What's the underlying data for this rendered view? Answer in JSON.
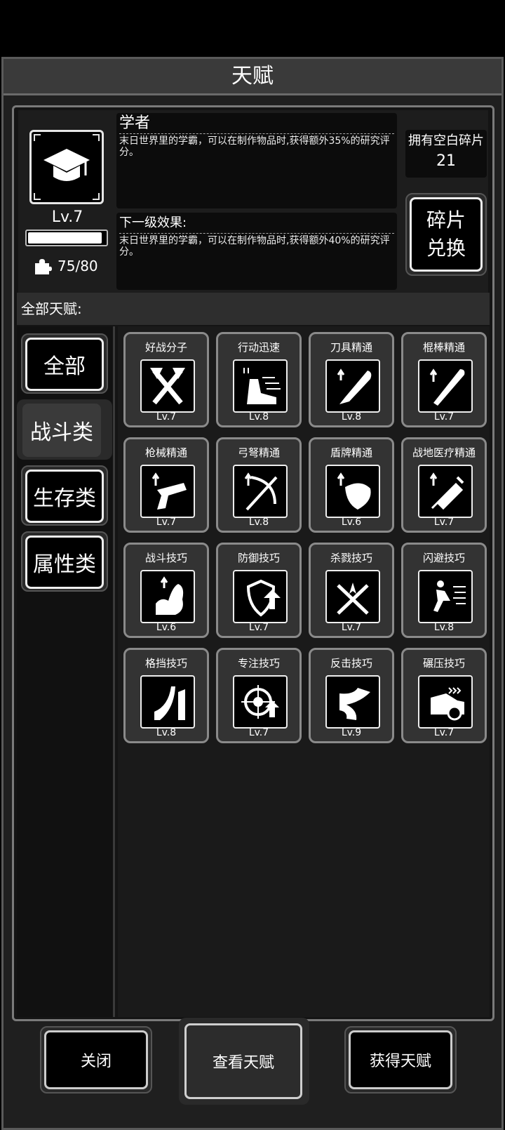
{
  "window": {
    "title": "天赋"
  },
  "talent": {
    "level": "Lv.7",
    "exp_fraction": 0.95,
    "fragments": "75/80",
    "name": "学者",
    "description": "末日世界里的学霸，可以在制作物品时,获得额外35%的研究评分。",
    "next_title": "下一级效果:",
    "next_description": "末日世界里的学霸，可以在制作物品时,获得额外40%的研究评分。",
    "icon": "graduation-cap-icon"
  },
  "fragments_panel": {
    "label": "拥有空白碎片",
    "value": "21",
    "exchange_button": "碎片兑换"
  },
  "section_label": "全部天赋:",
  "categories": [
    {
      "label": "全部",
      "active": false
    },
    {
      "label": "战斗类",
      "active": true
    },
    {
      "label": "生存类",
      "active": false
    },
    {
      "label": "属性类",
      "active": false
    }
  ],
  "talents": [
    {
      "name": "好战分子",
      "level": "Lv.7",
      "icon": "crossed-axes-icon"
    },
    {
      "name": "行动迅速",
      "level": "Lv.8",
      "icon": "fast-boot-icon"
    },
    {
      "name": "刀具精通",
      "level": "Lv.8",
      "icon": "machete-icon"
    },
    {
      "name": "棍棒精通",
      "level": "Lv.7",
      "icon": "bat-icon"
    },
    {
      "name": "枪械精通",
      "level": "Lv.7",
      "icon": "pistol-icon"
    },
    {
      "name": "弓弩精通",
      "level": "Lv.8",
      "icon": "crossbow-icon"
    },
    {
      "name": "盾牌精通",
      "level": "Lv.6",
      "icon": "shield-icon"
    },
    {
      "name": "战地医疗精通",
      "level": "Lv.7",
      "icon": "syringe-icon"
    },
    {
      "name": "战斗技巧",
      "level": "Lv.6",
      "icon": "flex-arm-icon"
    },
    {
      "name": "防御技巧",
      "level": "Lv.7",
      "icon": "defense-shield-icon"
    },
    {
      "name": "杀戮技巧",
      "level": "Lv.7",
      "icon": "crossed-swords-icon"
    },
    {
      "name": "闪避技巧",
      "level": "Lv.8",
      "icon": "dodge-icon"
    },
    {
      "name": "格挡技巧",
      "level": "Lv.8",
      "icon": "block-icon"
    },
    {
      "name": "专注技巧",
      "level": "Lv.7",
      "icon": "crosshair-icon"
    },
    {
      "name": "反击技巧",
      "level": "Lv.9",
      "icon": "counter-icon"
    },
    {
      "name": "碾压技巧",
      "level": "Lv.7",
      "icon": "car-crush-icon"
    }
  ],
  "buttons": {
    "close": "关闭",
    "view": "查看天赋",
    "get": "获得天赋"
  }
}
